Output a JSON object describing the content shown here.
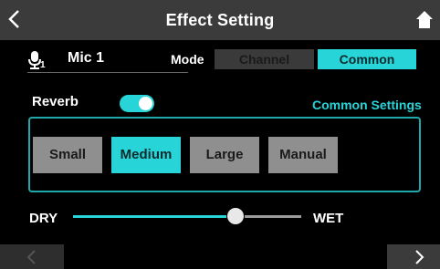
{
  "header": {
    "title": "Effect Setting",
    "back_icon": "chevron-left-icon",
    "home_icon": "home-icon"
  },
  "input": {
    "mic_icon": "microphone-icon",
    "mic_subscript": "1",
    "label": "Mic 1"
  },
  "mode": {
    "label": "Mode",
    "options": [
      "Channel",
      "Common"
    ],
    "selected": "Common"
  },
  "reverb": {
    "label": "Reverb",
    "enabled": true,
    "common_settings_link": "Common Settings"
  },
  "presets": {
    "options": [
      "Small",
      "Medium",
      "Large",
      "Manual"
    ],
    "selected": "Medium"
  },
  "mix": {
    "dry_label": "DRY",
    "wet_label": "WET",
    "value_fraction": 0.71
  },
  "footer": {
    "prev_icon": "chevron-left-icon",
    "next_icon": "chevron-right-icon"
  },
  "colors": {
    "accent": "#27d4d8",
    "header_bg": "#3b3b3b",
    "button_bg": "#8f8f8f"
  }
}
